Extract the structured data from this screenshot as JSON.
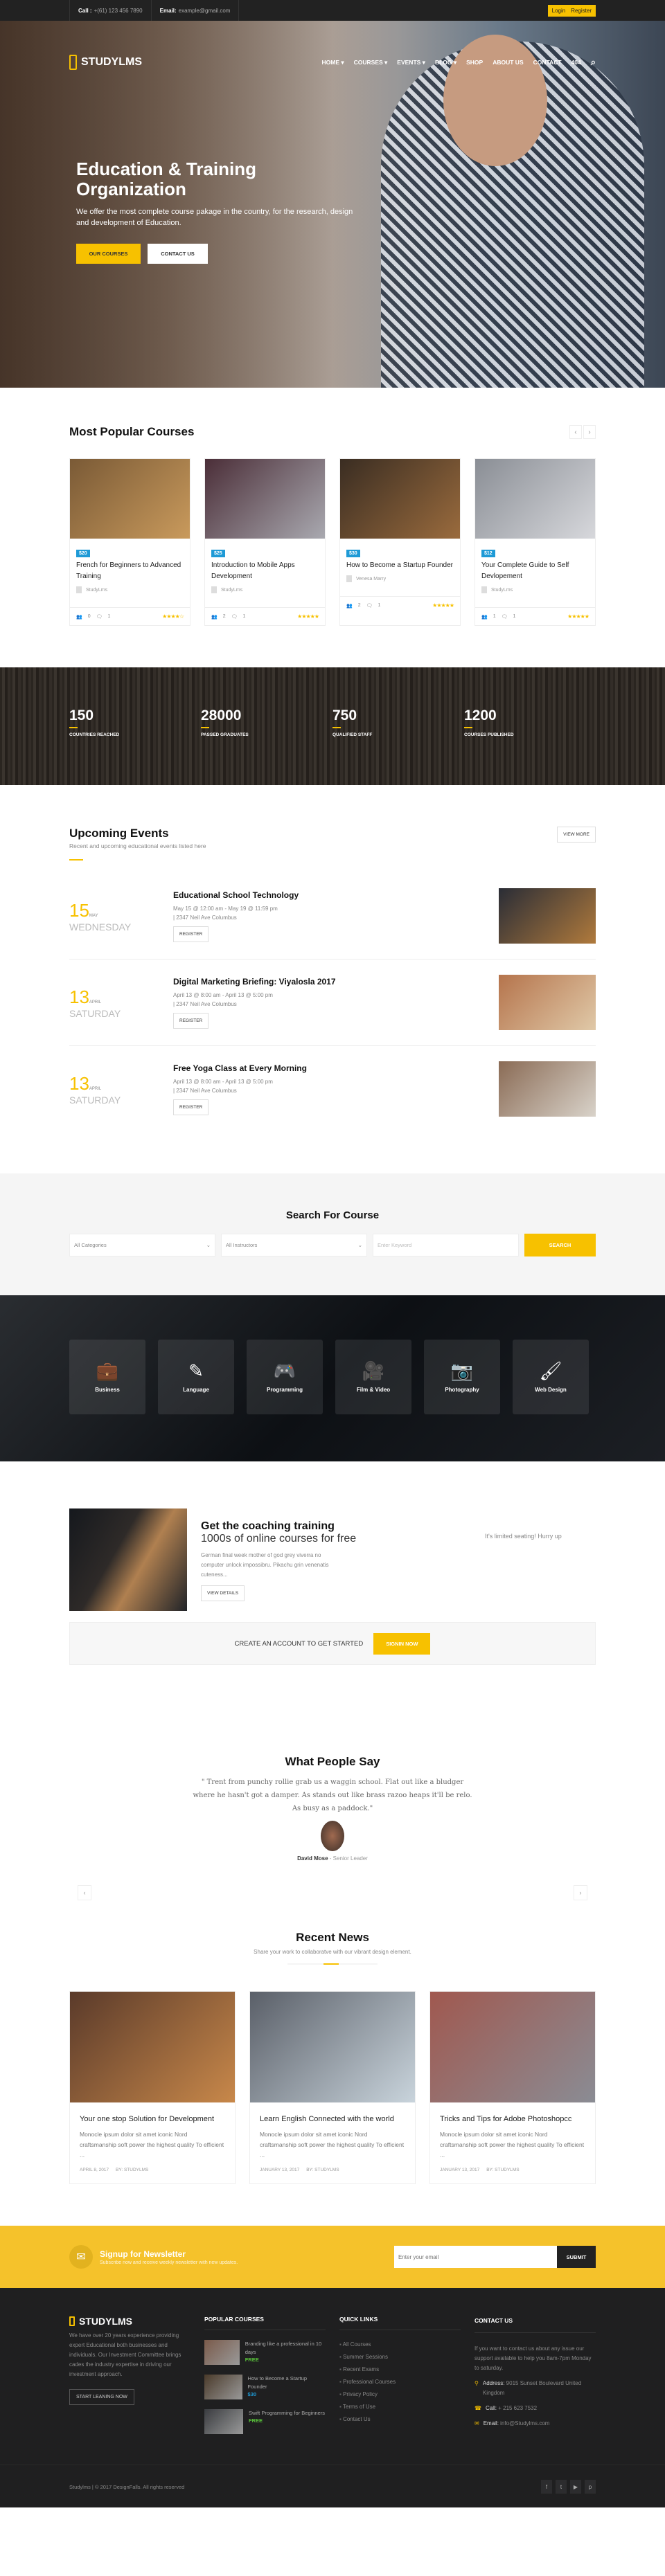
{
  "topbar": {
    "call_label": "Call :",
    "call_value": "+(61) 123 456 7890",
    "email_label": "Email:",
    "email_value": "example@gmail.com",
    "login": "Login",
    "register": "Register"
  },
  "brand": {
    "name": "STUDYLMS",
    "accent": "#f7c100"
  },
  "nav": {
    "items": [
      "HOME ▾",
      "COURSES ▾",
      "EVENTS ▾",
      "BLOG ▾",
      "SHOP",
      "ABOUT US",
      "CONTACT",
      "404"
    ],
    "search_icon": "search-icon"
  },
  "hero": {
    "title": "Education & Training Organization",
    "text": "We offer the most complete course pakage in the country, for the research, design and development of Education.",
    "btn_primary": "OUR COURSES",
    "btn_secondary": "CONTACT US"
  },
  "courses": {
    "title": "Most Popular Courses",
    "prev": "‹",
    "next": "›",
    "items": [
      {
        "price": "$20",
        "title": "French for Beginners to Advanced Training",
        "author": "StudyLms",
        "students": "0",
        "comments": "1",
        "rating": "★★★★☆",
        "colors": [
          "#7a5a36",
          "#c99a5c"
        ]
      },
      {
        "price": "$25",
        "title": "Introduction to Mobile Apps Development",
        "author": "StudyLms",
        "students": "2",
        "comments": "1",
        "rating": "★★★★★",
        "colors": [
          "#4b2e38",
          "#a9a9b0"
        ]
      },
      {
        "price": "$30",
        "title": "How to Become a Startup Founder",
        "author": "Venesa Marry",
        "students": "2",
        "comments": "1",
        "rating": "★★★★★",
        "colors": [
          "#3a2d22",
          "#9a6b3d"
        ]
      },
      {
        "price": "$12",
        "title": "Your Complete Guide to Self Devlopement",
        "author": "StudyLms",
        "students": "1",
        "comments": "1",
        "rating": "★★★★★",
        "colors": [
          "#8a8e95",
          "#d7d8dc"
        ]
      }
    ]
  },
  "counters": [
    {
      "value": "150",
      "label": "COUNTRIES REACHED"
    },
    {
      "value": "28000",
      "label": "PASSED GRADUATES"
    },
    {
      "value": "750",
      "label": "QUALIFIED STAFF"
    },
    {
      "value": "1200",
      "label": "COURSES PUBLISHED"
    }
  ],
  "events": {
    "title": "Upcoming Events",
    "subtitle": "Recent and upcoming educational events listed here",
    "view_more": "VIEW MORE",
    "items": [
      {
        "day": "15",
        "month": "MAY",
        "weekday": "WEDNESDAY",
        "title": "Educational School Technology",
        "time": "May 15 @ 12:00 am - May 19 @ 11:59 pm",
        "location": "| 2347 Neil Ave Columbus",
        "register": "REGISTER",
        "colors": [
          "#2a2d36",
          "#b07a3c"
        ]
      },
      {
        "day": "13",
        "month": "APRIL",
        "weekday": "SATURDAY",
        "title": "Digital Marketing Briefing: Viyalosla 2017",
        "time": "April 13 @ 8:00 am - April 13 @ 5:00 pm",
        "location": "| 2347 Neil Ave Columbus",
        "register": "REGISTER",
        "colors": [
          "#b5744c",
          "#e0c9a8"
        ]
      },
      {
        "day": "13",
        "month": "APRIL",
        "weekday": "SATURDAY",
        "title": "Free Yoga Class at Every Morning",
        "time": "April 13 @ 8:00 am - April 13 @ 5:00 pm",
        "location": "| 2347 Neil Ave Columbus",
        "register": "REGISTER",
        "colors": [
          "#8a6b55",
          "#d9d3ca"
        ]
      }
    ]
  },
  "search": {
    "title": "Search For Course",
    "category": "All Categories",
    "instructor": "All Instructors",
    "keyword_placeholder": "Enter Keyword",
    "button": "SEARCH"
  },
  "categories": [
    {
      "label": "Business",
      "icon": "briefcase-icon",
      "glyph": "💼"
    },
    {
      "label": "Language",
      "icon": "pencil-icon",
      "glyph": "✎"
    },
    {
      "label": "Programming",
      "icon": "gamepad-icon",
      "glyph": "🎮"
    },
    {
      "label": "Film & Video",
      "icon": "video-camera-icon",
      "glyph": "🎥"
    },
    {
      "label": "Photography",
      "icon": "camera-icon",
      "glyph": "📷"
    },
    {
      "label": "Web Design",
      "icon": "brush-icon",
      "glyph": "🖌"
    }
  ],
  "coaching": {
    "title": "Get the coaching training",
    "subtitle": "1000s of online courses for free",
    "text": "German final week mother of god grey viverra no computer unlock impossibru. Pikachu grin venenatis cuteness...",
    "button": "VIEW DETAILS",
    "limited": "It's limited seating! Hurry up"
  },
  "cta": {
    "text": "CREATE AN ACCOUNT TO GET STARTED",
    "button": "SIGNIN NOW"
  },
  "testimonial": {
    "title": "What People Say",
    "quote": "\" Trent from punchy rollie grab us a waggin school. Flat out like a bludger where he hasn't got a damper. As stands out like brass razoo heaps it'll be relo. As busy as a paddock.\"",
    "name": "David Mose",
    "role": " - Senior Leader",
    "prev": "‹",
    "next": "›"
  },
  "news": {
    "title": "Recent News",
    "subtitle": "Share your work to collaboratve with our vibrant design element.",
    "items": [
      {
        "title": "Your one stop Solution for Development",
        "excerpt": "Monocle ipsum dolor sit amet iconic Nord craftsmanship soft power the highest quality To efficient ...",
        "date": "APRIL 8, 2017",
        "author": "BY: STUDYLMS",
        "colors": [
          "#5a3a2a",
          "#c8884a"
        ]
      },
      {
        "title": "Learn English Connected with the world",
        "excerpt": "Monocle ipsum dolor sit amet iconic Nord craftsmanship soft power the highest quality To efficient ...",
        "date": "JANUARY 13, 2017",
        "author": "BY: STUDYLMS",
        "colors": [
          "#5a5f68",
          "#c9d4dc"
        ]
      },
      {
        "title": "Tricks and Tips for Adobe Photoshopcc",
        "excerpt": "Monocle ipsum dolor sit amet iconic Nord craftsmanship soft power the highest quality To efficient ...",
        "date": "JANUARY 13, 2017",
        "author": "BY: STUDYLMS",
        "colors": [
          "#a0584f",
          "#8a8c94"
        ]
      }
    ]
  },
  "newsletter": {
    "title": "Signup for Newsletter",
    "text": "Subscribe now and receive weekly newsletter with new updates.",
    "placeholder": "Enter your email",
    "button": "SUBMIT"
  },
  "footer": {
    "about": "We have over 20 years experience providing expert Educational both businesses and individuals. Our Investment Committee brings cades the industry expertise in driving our investment approach.",
    "about_button": "START LEANING NOW",
    "popular_title": "POPULAR COURSES",
    "popular": [
      {
        "title": "Branding like a professional in 10 days",
        "price": "FREE",
        "type": "free",
        "color": "#7a5a4a"
      },
      {
        "title": "How to Become a Startup Founder",
        "price": "$30",
        "type": "paid",
        "color": "#4a3a2a"
      },
      {
        "title": "Swift Programming for Beginners",
        "price": "FREE",
        "type": "free",
        "color": "#3a3c40"
      }
    ],
    "links_title": "QUICK LINKS",
    "links": [
      "All Courses",
      "Summer Sessions",
      "Recent Exams",
      "Professional Courses",
      "Privacy Policy",
      "Terms of Use",
      "Contact Us"
    ],
    "contact_title": "CONTACT US",
    "contact_text": "If you want to contact us about any issue our support available to help you 8am-7pm Monday to saturday.",
    "address_label": "Address:",
    "address": "9015 Sunset Boulevard United Kingdom",
    "call_label": "Call:",
    "call": "+ 215 623 7532",
    "email_label": "Email:",
    "email": "info@Studylms.com",
    "copyright": "Studylms | © 2017 DesignFalls. All rights reserved",
    "social": [
      "f",
      "t",
      "▶",
      "p"
    ]
  }
}
